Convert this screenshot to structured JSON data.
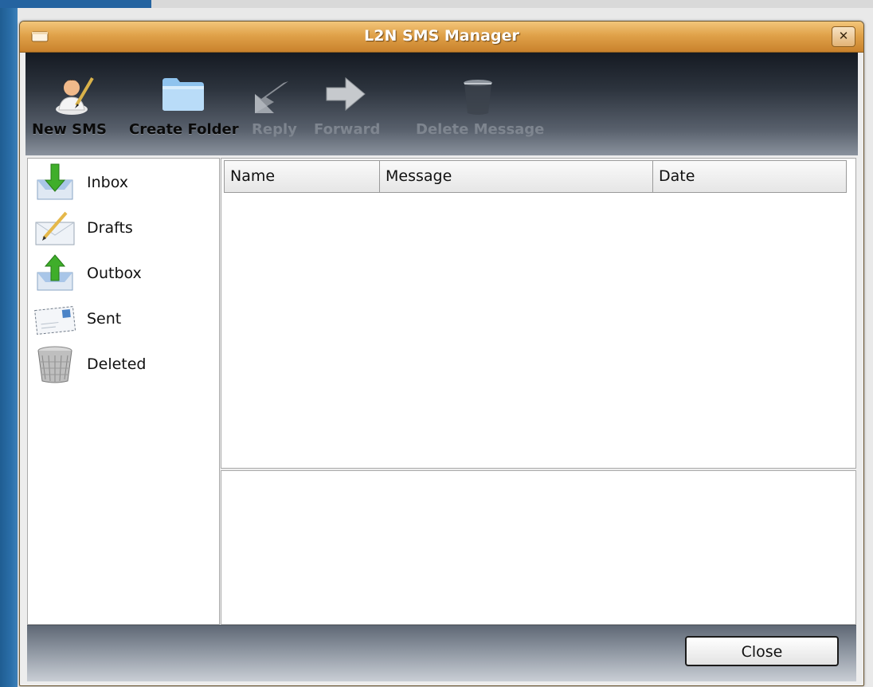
{
  "window": {
    "title": "L2N SMS Manager",
    "close_glyph": "✕"
  },
  "toolbar": {
    "items": [
      {
        "label": "New SMS",
        "icon": "new-sms-person-pen-icon",
        "enabled": true
      },
      {
        "label": "Create Folder",
        "icon": "folder-icon",
        "enabled": true
      },
      {
        "label": "Reply",
        "icon": "reply-arrow-icon",
        "enabled": false
      },
      {
        "label": "Forward",
        "icon": "forward-arrow-icon",
        "enabled": false
      },
      {
        "label": "Delete Message",
        "icon": "trash-can-icon",
        "enabled": false
      }
    ]
  },
  "sidebar": {
    "folders": [
      {
        "label": "Inbox",
        "icon": "inbox-icon"
      },
      {
        "label": "Drafts",
        "icon": "drafts-icon"
      },
      {
        "label": "Outbox",
        "icon": "outbox-icon"
      },
      {
        "label": "Sent",
        "icon": "sent-envelope-icon"
      },
      {
        "label": "Deleted",
        "icon": "wastebasket-icon"
      }
    ]
  },
  "message_list": {
    "columns": [
      "Name",
      "Message",
      "Date"
    ],
    "rows": []
  },
  "footer": {
    "close_label": "Close"
  },
  "colors": {
    "titlebar": "#e0a24a",
    "toolbar": "#2c333d",
    "desktop": "#2a6ea8"
  }
}
